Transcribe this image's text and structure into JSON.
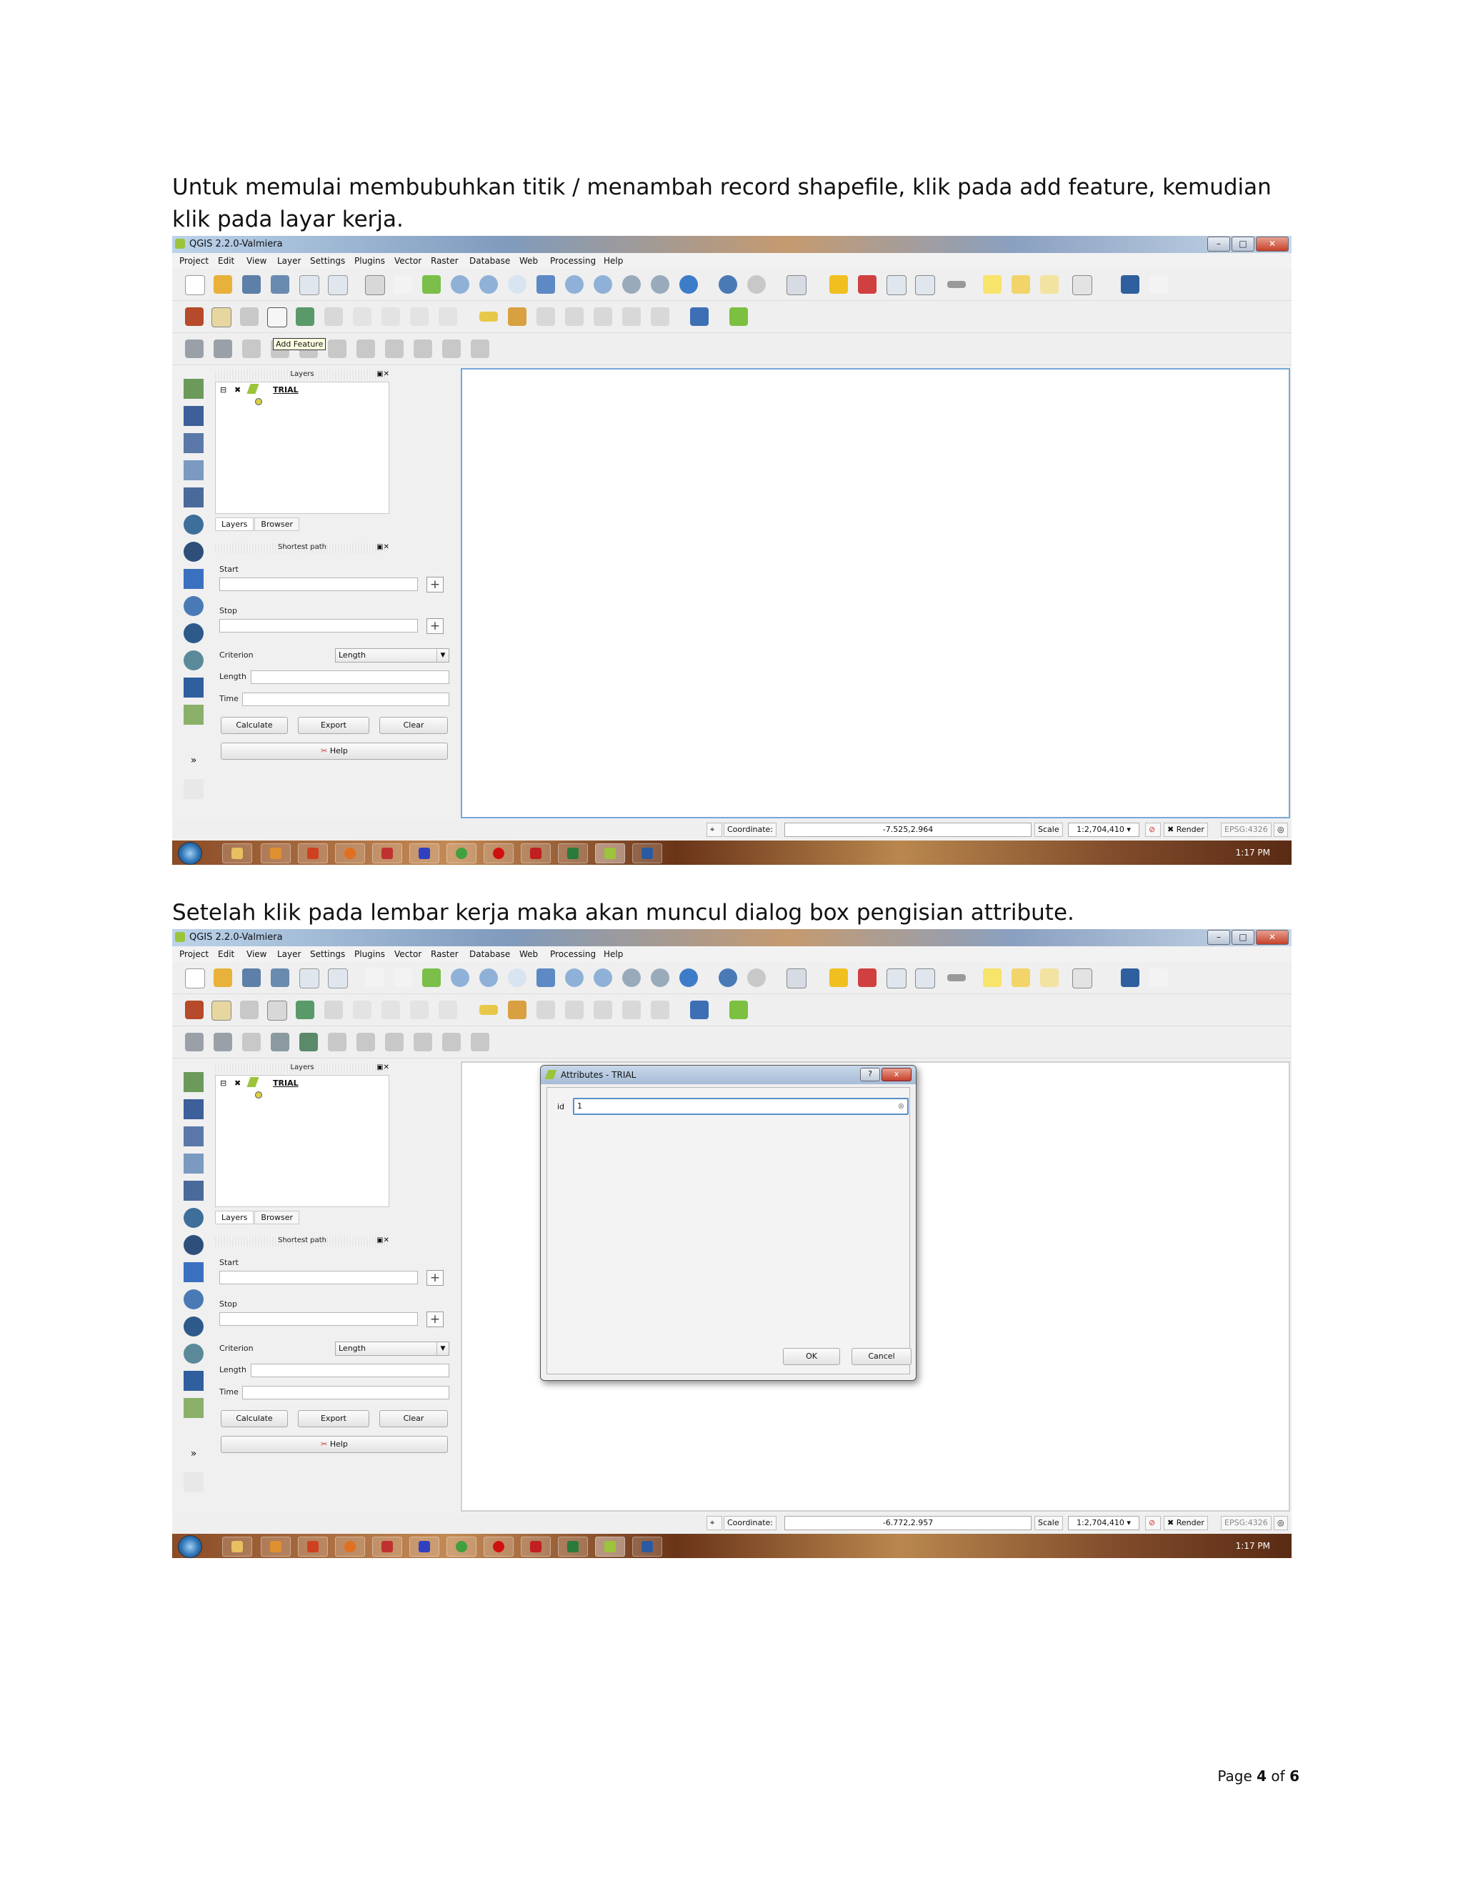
{
  "document": {
    "paragraph_1": "Untuk memulai membubuhkan titik / menambah record shapefile, klik pada add feature, kemudian klik pada layar kerja.",
    "paragraph_2": "Setelah klik pada lembar kerja maka akan muncul dialog box pengisian attribute.",
    "footer": {
      "prefix": "Page ",
      "current": "4",
      "middle": " of ",
      "total": "6"
    }
  },
  "qgis": {
    "window_title": "QGIS 2.2.0-Valmiera",
    "menu": [
      "Project",
      "Edit",
      "View",
      "Layer",
      "Settings",
      "Plugins",
      "Vector",
      "Raster",
      "Database",
      "Web",
      "Processing",
      "Help"
    ],
    "layers_panel_title": "Layers",
    "layer_name": "TRIAL",
    "tabs": [
      "Layers",
      "Browser"
    ],
    "shortest_path_title": "Shortest path",
    "start_label": "Start",
    "stop_label": "Stop",
    "criterion_label": "Criterion",
    "criterion_value": "Length",
    "length_label": "Length",
    "time_label": "Time",
    "calculate_label": "Calculate",
    "export_label": "Export",
    "clear_label": "Clear",
    "help_label": "Help",
    "coordinate_label": "Coordinate:",
    "scale_label": "Scale",
    "scale_value": "1:2,704,410",
    "render_label": "Render",
    "epsg_label": "EPSG:4326",
    "clock": "1:17 PM",
    "tooltip_add_feature": "Add Feature"
  },
  "screenshot_1": {
    "coordinate_value": "-7.525,2.964"
  },
  "screenshot_2": {
    "coordinate_value": "-6.772,2.957",
    "dialog_title": "Attributes - TRIAL",
    "dialog_help": "?",
    "dialog_close": "x",
    "field_label": "id",
    "field_value": "1",
    "ok_label": "OK",
    "cancel_label": "Cancel"
  },
  "colors": {
    "canvas_border": "#78a8d8",
    "taskbar": "#8a4b26",
    "titlebar": "#a6bbd6"
  }
}
